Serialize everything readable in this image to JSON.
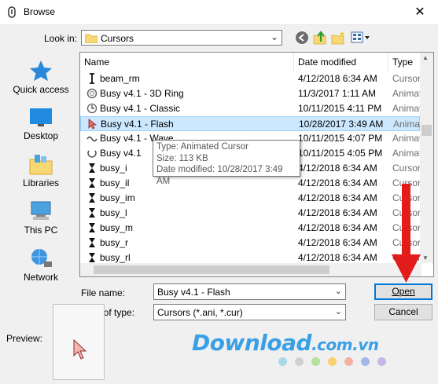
{
  "window": {
    "title": "Browse",
    "close_glyph": "✕"
  },
  "toolbar": {
    "lookin_label": "Look in:",
    "lookin_value": "Cursors"
  },
  "places": [
    {
      "label": "Quick access",
      "icon": "star-icon"
    },
    {
      "label": "Desktop",
      "icon": "desktop-icon"
    },
    {
      "label": "Libraries",
      "icon": "libraries-icon"
    },
    {
      "label": "This PC",
      "icon": "computer-icon"
    },
    {
      "label": "Network",
      "icon": "network-icon"
    }
  ],
  "columns": {
    "name": "Name",
    "date": "Date modified",
    "type": "Type"
  },
  "files": [
    {
      "name": "beam_rm",
      "date": "4/12/2018 6:34 AM",
      "type": "Cursor",
      "icon": "ibeam-icon"
    },
    {
      "name": "Busy v4.1 - 3D Ring",
      "date": "11/3/2017 1:11 AM",
      "type": "Animat",
      "icon": "ring-icon"
    },
    {
      "name": "Busy v4.1 - Classic",
      "date": "10/11/2015 4:11 PM",
      "type": "Animat",
      "icon": "clock-icon"
    },
    {
      "name": "Busy v4.1 - Flash",
      "date": "10/28/2017 3:49 AM",
      "type": "Animat",
      "icon": "arrow-cursor-icon",
      "selected": true
    },
    {
      "name": "Busy v4.1 - Wave",
      "date": "10/11/2015 4:07 PM",
      "type": "Animat",
      "icon": "wave-icon"
    },
    {
      "name": "Busy v4.1",
      "date": "10/11/2015 4:05 PM",
      "type": "Animat",
      "icon": "busy-ring-icon"
    },
    {
      "name": "busy_i",
      "date": "4/12/2018 6:34 AM",
      "type": "Cursor",
      "icon": "hourglass-icon"
    },
    {
      "name": "busy_il",
      "date": "4/12/2018 6:34 AM",
      "type": "Cursor",
      "icon": "hourglass-icon"
    },
    {
      "name": "busy_im",
      "date": "4/12/2018 6:34 AM",
      "type": "Cursor",
      "icon": "hourglass-icon"
    },
    {
      "name": "busy_l",
      "date": "4/12/2018 6:34 AM",
      "type": "Cursor",
      "icon": "hourglass-icon"
    },
    {
      "name": "busy_m",
      "date": "4/12/2018 6:34 AM",
      "type": "Cursor",
      "icon": "hourglass-icon"
    },
    {
      "name": "busy_r",
      "date": "4/12/2018 6:34 AM",
      "type": "Cursor",
      "icon": "hourglass-icon"
    },
    {
      "name": "busy_rl",
      "date": "4/12/2018 6:34 AM",
      "type": "Cursor",
      "icon": "hourglass-icon"
    }
  ],
  "tooltip": {
    "type": "Type: Animated Cursor",
    "size": "Size: 113 KB",
    "date": "Date modified: 10/28/2017 3:49 AM"
  },
  "form": {
    "filename_label": "File name:",
    "filename_value": "Busy v4.1 - Flash",
    "filetype_label": "Files of type:",
    "filetype_value": "Cursors (*.ani, *.cur)",
    "open_label": "Open",
    "cancel_label": "Cancel"
  },
  "preview": {
    "label": "Preview:"
  },
  "watermark": {
    "brand": "Download",
    "tld": ".com.vn",
    "dot_colors": [
      "#a8d8ea",
      "#d0d0d0",
      "#b5e0a0",
      "#f7d070",
      "#f5b0a0",
      "#9fb8e8",
      "#c5b8e8"
    ]
  },
  "colors": {
    "selection": "#cce8ff",
    "accent": "#0078d7",
    "annotation_arrow": "#e21b1b"
  }
}
